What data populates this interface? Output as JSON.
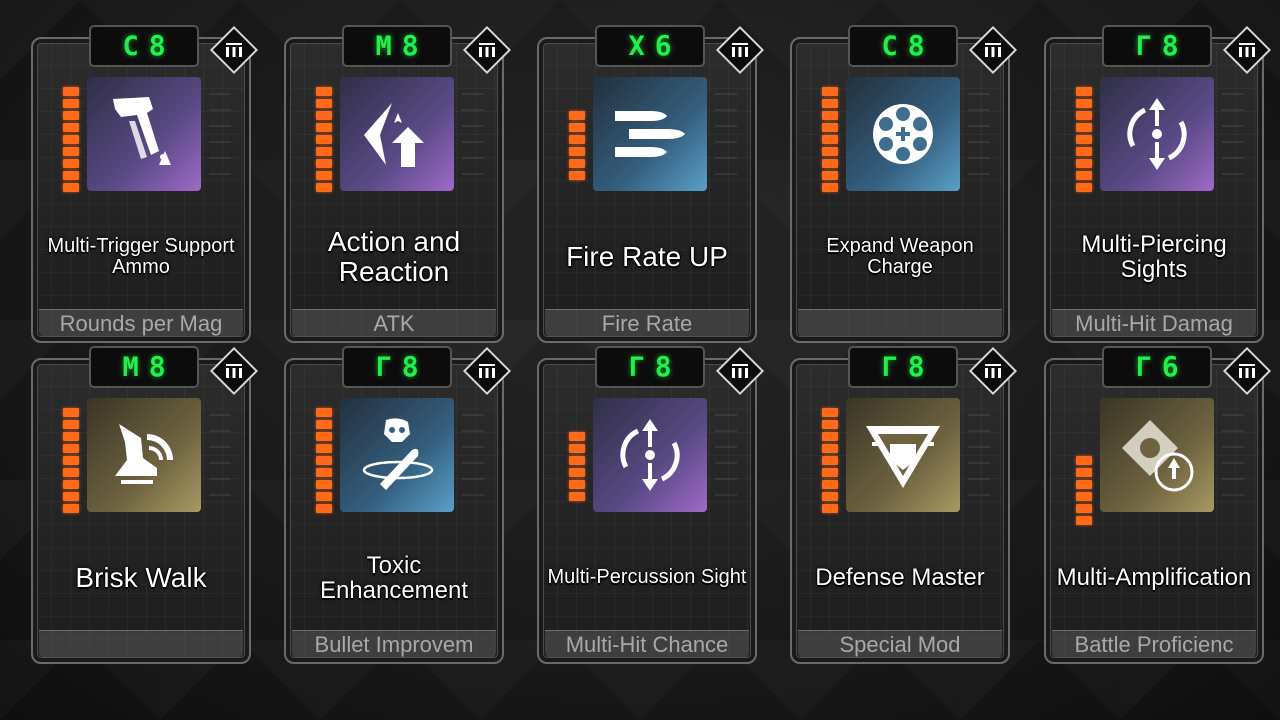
{
  "cards": [
    {
      "grade": "C",
      "level": "8",
      "title": "Multi-Trigger Support Ammo",
      "category": "Rounds per Mag",
      "icon": "multi-trigger-ammo-icon",
      "color": "purple",
      "ammo": 9
    },
    {
      "grade": "M",
      "level": "8",
      "title": "Action and Reaction",
      "category": "ATK",
      "icon": "atk-up-arrow-icon",
      "color": "purple",
      "ammo": 9
    },
    {
      "grade": "X",
      "level": "6",
      "title": "Fire Rate UP",
      "category": "Fire Rate",
      "icon": "bullets-icon",
      "color": "blue",
      "ammo": 6
    },
    {
      "grade": "C",
      "level": "8",
      "title": "Expand Weapon Charge",
      "category": "",
      "icon": "revolver-cylinder-icon",
      "color": "blue",
      "ammo": 9
    },
    {
      "grade": "Γ",
      "level": "8",
      "title": "Multi-Piercing Sights",
      "category": "Multi-Hit Damag",
      "icon": "piercing-sight-icon",
      "color": "purple",
      "ammo": 9
    },
    {
      "grade": "M",
      "level": "8",
      "title": "Brisk Walk",
      "category": "",
      "icon": "brisk-walk-icon",
      "color": "gold",
      "ammo": 9
    },
    {
      "grade": "Γ",
      "level": "8",
      "title": "Toxic Enhancement",
      "category": "Bullet Improvem",
      "icon": "toxic-bullet-icon",
      "color": "blue",
      "ammo": 9
    },
    {
      "grade": "Γ",
      "level": "8",
      "title": "Multi-Percussion Sight",
      "category": "Multi-Hit Chance",
      "icon": "percussion-sight-icon",
      "color": "purple",
      "ammo": 6
    },
    {
      "grade": "Γ",
      "level": "8",
      "title": "Defense Master",
      "category": "Special Mod",
      "icon": "defense-shield-icon",
      "color": "gold",
      "ammo": 9
    },
    {
      "grade": "Γ",
      "level": "6",
      "title": "Multi-Amplification",
      "category": "Battle Proficienc",
      "icon": "amplification-icon",
      "color": "gold",
      "ammo": 6
    }
  ]
}
